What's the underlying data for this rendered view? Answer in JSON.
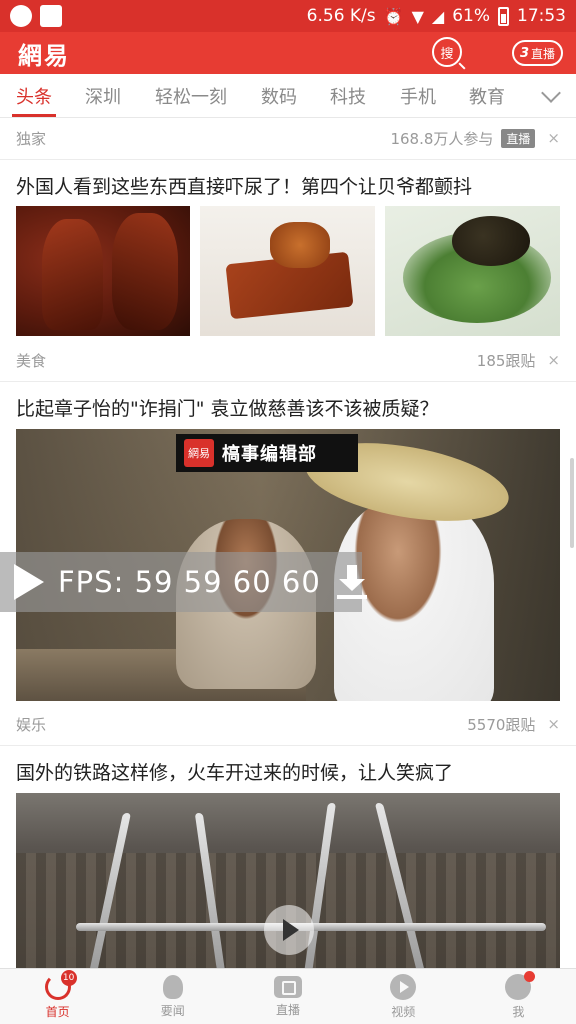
{
  "status_bar": {
    "speed": "6.56 K/s",
    "battery": "61%",
    "time": "17:53",
    "icons": [
      "tool-icon",
      "pulse-icon",
      "alarm-icon",
      "wifi-icon",
      "signal-icon",
      "battery-icon"
    ]
  },
  "header": {
    "logo": "網易",
    "search_label": "搜",
    "live_count": "3",
    "live_label": "直播"
  },
  "tabs": [
    "头条",
    "深圳",
    "轻松一刻",
    "数码",
    "科技",
    "手机",
    "教育"
  ],
  "feed": {
    "top_meta": {
      "source": "独家",
      "participants": "168.8万人参与",
      "badge": "直播",
      "close": "×"
    },
    "item1": {
      "title": "外国人看到这些东西直接吓尿了！第四个让贝爷都颤抖",
      "category": "美食",
      "comments": "185跟贴",
      "close": "×"
    },
    "item2": {
      "title": "比起章子怡的\"诈捐门\" 袁立做慈善该不该被质疑？",
      "brand_logo": "網易",
      "brand_name": "槁事编辑部",
      "category": "娱乐",
      "comments": "5570跟贴",
      "close": "×"
    },
    "item3": {
      "title": "国外的铁路这样修，火车开过来的时候，让人笑疯了"
    }
  },
  "fps_overlay": {
    "text": "FPS: 59  59  60  60"
  },
  "bottom_nav": [
    {
      "label": "首页",
      "icon": "home-refresh-icon",
      "badge": "10"
    },
    {
      "label": "要闻",
      "icon": "bulb-icon"
    },
    {
      "label": "直播",
      "icon": "camera-icon"
    },
    {
      "label": "视频",
      "icon": "play-icon"
    },
    {
      "label": "我",
      "icon": "user-icon"
    }
  ],
  "colors": {
    "brand_red": "#e73c33",
    "status_red": "#d9312b",
    "text": "#222222",
    "muted": "#9a9a9a"
  }
}
